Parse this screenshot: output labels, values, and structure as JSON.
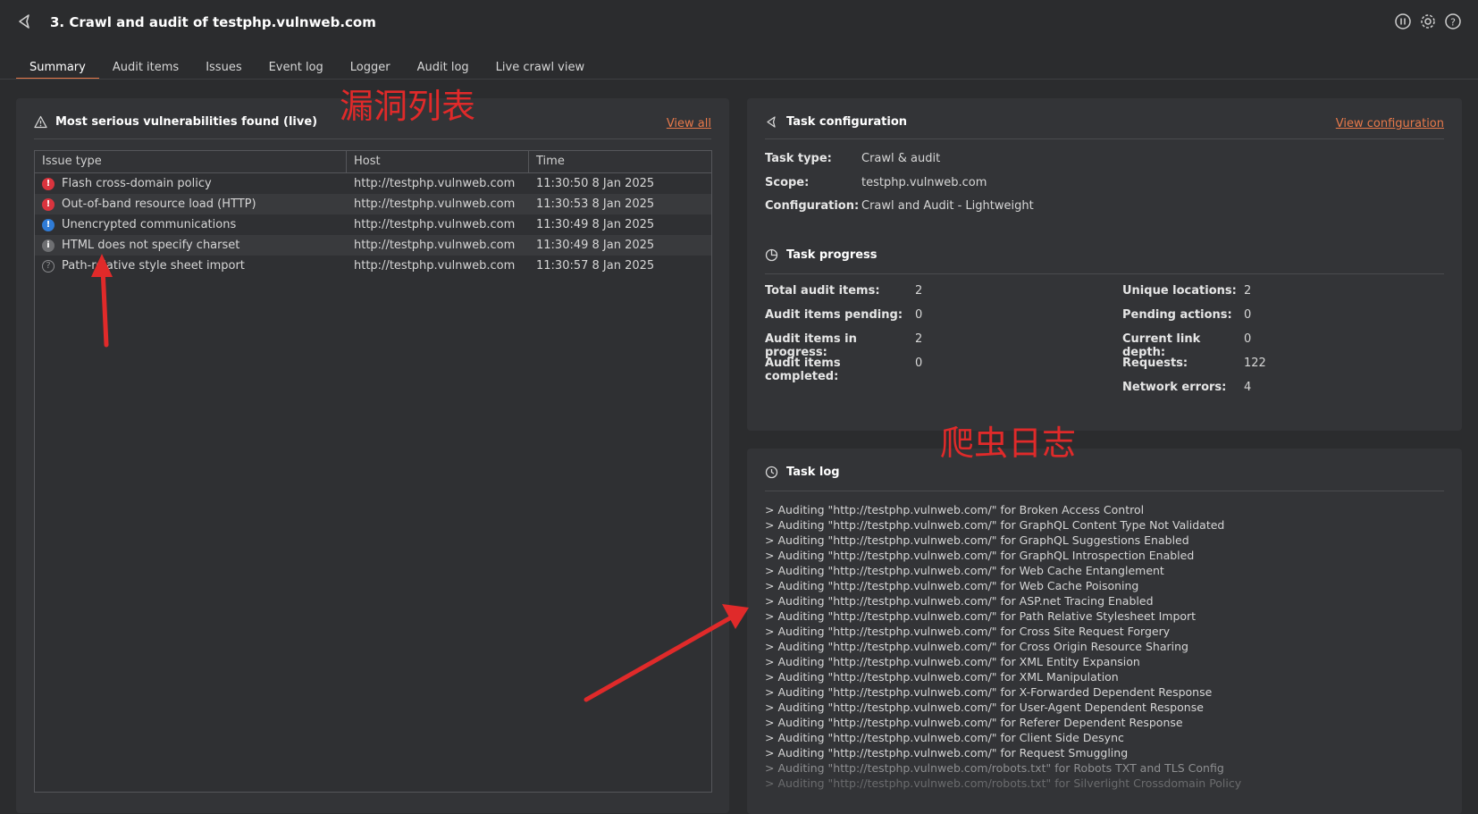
{
  "header": {
    "title": "3. Crawl and audit of testphp.vulnweb.com"
  },
  "tabs": [
    {
      "label": "Summary",
      "active": true
    },
    {
      "label": "Audit items"
    },
    {
      "label": "Issues"
    },
    {
      "label": "Event log"
    },
    {
      "label": "Logger"
    },
    {
      "label": "Audit log"
    },
    {
      "label": "Live crawl view"
    }
  ],
  "vulns": {
    "title": "Most serious vulnerabilities found (live)",
    "view_all": "View all",
    "columns": [
      "Issue type",
      "Host",
      "Time"
    ],
    "rows": [
      {
        "severity": "high",
        "type": "Flash cross-domain policy",
        "host": "http://testphp.vulnweb.com",
        "time": "11:30:50 8 Jan 2025"
      },
      {
        "severity": "high",
        "type": "Out-of-band resource load (HTTP)",
        "host": "http://testphp.vulnweb.com",
        "time": "11:30:53 8 Jan 2025"
      },
      {
        "severity": "info-blue",
        "type": "Unencrypted communications",
        "host": "http://testphp.vulnweb.com",
        "time": "11:30:49 8 Jan 2025"
      },
      {
        "severity": "info",
        "type": "HTML does not specify charset",
        "host": "http://testphp.vulnweb.com",
        "time": "11:30:49 8 Jan 2025"
      },
      {
        "severity": "tentative",
        "type": "Path-relative style sheet import",
        "host": "http://testphp.vulnweb.com",
        "time": "11:30:57 8 Jan 2025"
      }
    ]
  },
  "config": {
    "title": "Task configuration",
    "view_link": "View configuration",
    "task_type_label": "Task type:",
    "task_type": "Crawl & audit",
    "scope_label": "Scope:",
    "scope": "testphp.vulnweb.com",
    "configuration_label": "Configuration:",
    "configuration": "Crawl and Audit - Lightweight"
  },
  "progress": {
    "title": "Task progress",
    "left": [
      {
        "label": "Total audit items:",
        "value": "2"
      },
      {
        "label": "Audit items pending:",
        "value": "0"
      },
      {
        "label": "Audit items in progress:",
        "value": "2"
      },
      {
        "label": "Audit items completed:",
        "value": "0"
      }
    ],
    "right": [
      {
        "label": "Unique locations:",
        "value": "2"
      },
      {
        "label": "Pending actions:",
        "value": "0"
      },
      {
        "label": "Current link depth:",
        "value": "0"
      },
      {
        "label": "Requests:",
        "value": "122"
      },
      {
        "label": "Network errors:",
        "value": "4"
      }
    ]
  },
  "log": {
    "title": "Task log",
    "lines": [
      "> Auditing \"http://testphp.vulnweb.com/\" for Broken Access Control",
      "> Auditing \"http://testphp.vulnweb.com/\" for GraphQL Content Type Not Validated",
      "> Auditing \"http://testphp.vulnweb.com/\" for GraphQL Suggestions Enabled",
      "> Auditing \"http://testphp.vulnweb.com/\" for GraphQL Introspection Enabled",
      "> Auditing \"http://testphp.vulnweb.com/\" for Web Cache Entanglement",
      "> Auditing \"http://testphp.vulnweb.com/\" for Web Cache Poisoning",
      "> Auditing \"http://testphp.vulnweb.com/\" for ASP.net Tracing Enabled",
      "> Auditing \"http://testphp.vulnweb.com/\" for Path Relative Stylesheet Import",
      "> Auditing \"http://testphp.vulnweb.com/\" for Cross Site Request Forgery",
      "> Auditing \"http://testphp.vulnweb.com/\" for Cross Origin Resource Sharing",
      "> Auditing \"http://testphp.vulnweb.com/\" for XML Entity Expansion",
      "> Auditing \"http://testphp.vulnweb.com/\" for XML Manipulation",
      "> Auditing \"http://testphp.vulnweb.com/\" for X-Forwarded Dependent Response",
      "> Auditing \"http://testphp.vulnweb.com/\" for User-Agent Dependent Response",
      "> Auditing \"http://testphp.vulnweb.com/\" for Referer Dependent Response",
      "> Auditing \"http://testphp.vulnweb.com/\" for Client Side Desync",
      "> Auditing \"http://testphp.vulnweb.com/\" for Request Smuggling",
      "> Auditing \"http://testphp.vulnweb.com/robots.txt\" for Robots TXT and TLS Config",
      "> Auditing \"http://testphp.vulnweb.com/robots.txt\" for Silverlight Crossdomain Policy"
    ]
  },
  "annotations": {
    "vuln_list": "漏洞列表",
    "crawl_log": "爬虫日志"
  },
  "colors": {
    "background": "#2b2c2e",
    "panel": "#333437",
    "accent": "#e8794a",
    "high": "#d9343e",
    "info_blue": "#2f7bd6",
    "annotation": "#e02a2a"
  }
}
